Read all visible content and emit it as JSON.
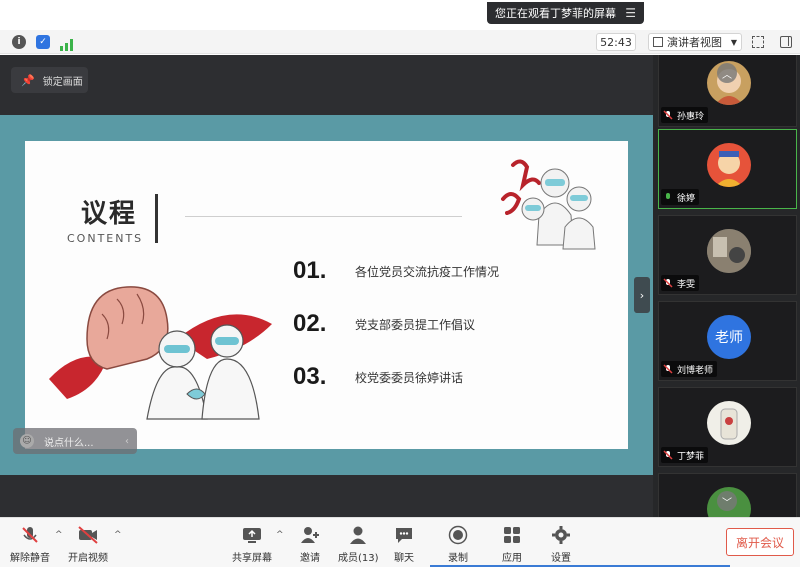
{
  "top": {
    "watching_banner": "您正在观看丁梦菲的屏幕",
    "timer": "52:43",
    "view_mode": "演讲者视图"
  },
  "stage": {
    "lock_label": "锁定画面",
    "chat_placeholder": "说点什么...",
    "slide": {
      "title": "议程",
      "subtitle": "CONTENTS",
      "items": [
        {
          "num": "01.",
          "text": "各位党员交流抗疫工作情况"
        },
        {
          "num": "02.",
          "text": "党支部委员提工作倡议"
        },
        {
          "num": "03.",
          "text": "校党委委员徐婷讲话"
        }
      ],
      "accent_color": "#5a9aa5"
    }
  },
  "participants": [
    {
      "name": "孙惠玲",
      "muted": true
    },
    {
      "name": "徐婷",
      "muted": false,
      "active": true
    },
    {
      "name": "李雯",
      "muted": true
    },
    {
      "name": "刘博老师",
      "muted": true,
      "avatar_text": "老师"
    },
    {
      "name": "丁梦菲",
      "muted": true
    }
  ],
  "bottom": {
    "unmute": "解除静音",
    "start_video": "开启视频",
    "share_screen": "共享屏幕",
    "invite": "邀请",
    "members": "成员(13)",
    "chat": "聊天",
    "record": "录制",
    "apps": "应用",
    "settings": "设置",
    "leave": "离开会议"
  }
}
